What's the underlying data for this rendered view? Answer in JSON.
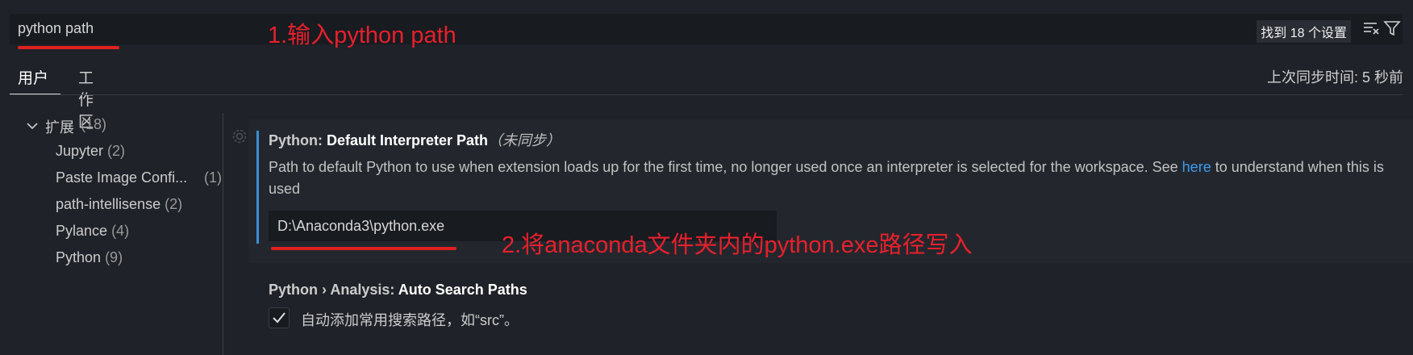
{
  "search": {
    "value": "python path",
    "result_count": "找到 18 个设置"
  },
  "annotations": {
    "step1": "1.输入python path",
    "step2": "2.将anaconda文件夹内的python.exe路径写入"
  },
  "tabs": [
    {
      "label": "用户",
      "active": true
    },
    {
      "label": "工作区",
      "active": false
    }
  ],
  "sync_status": "上次同步时间: 5 秒前",
  "toc": {
    "group": {
      "label": "扩展",
      "count": "(18)"
    },
    "items": [
      {
        "label": "Jupyter",
        "count": "(2)"
      },
      {
        "label": "Paste Image Confi...",
        "count": "(1)"
      },
      {
        "label": "path-intellisense",
        "count": "(2)"
      },
      {
        "label": "Pylance",
        "count": "(4)"
      },
      {
        "label": "Python",
        "count": "(9)"
      }
    ]
  },
  "settings": [
    {
      "category": "Python: ",
      "name": "Default Interpreter Path",
      "sync_note": "（未同步）",
      "description_before": "Path to default Python to use when extension loads up for the first time, no longer used once an interpreter is selected for the workspace. See ",
      "description_link": "here",
      "description_after": " to understand when this is used",
      "value": "D:\\Anaconda3\\python.exe"
    },
    {
      "category": "Python › Analysis: ",
      "name": "Auto Search Paths",
      "checkbox_label": "自动添加常用搜索路径，如“src”。",
      "checked": true
    }
  ],
  "colors": {
    "accent_blue": "#3b8fd6",
    "link": "#3c9cf0",
    "annotation_red": "#e8202c"
  }
}
